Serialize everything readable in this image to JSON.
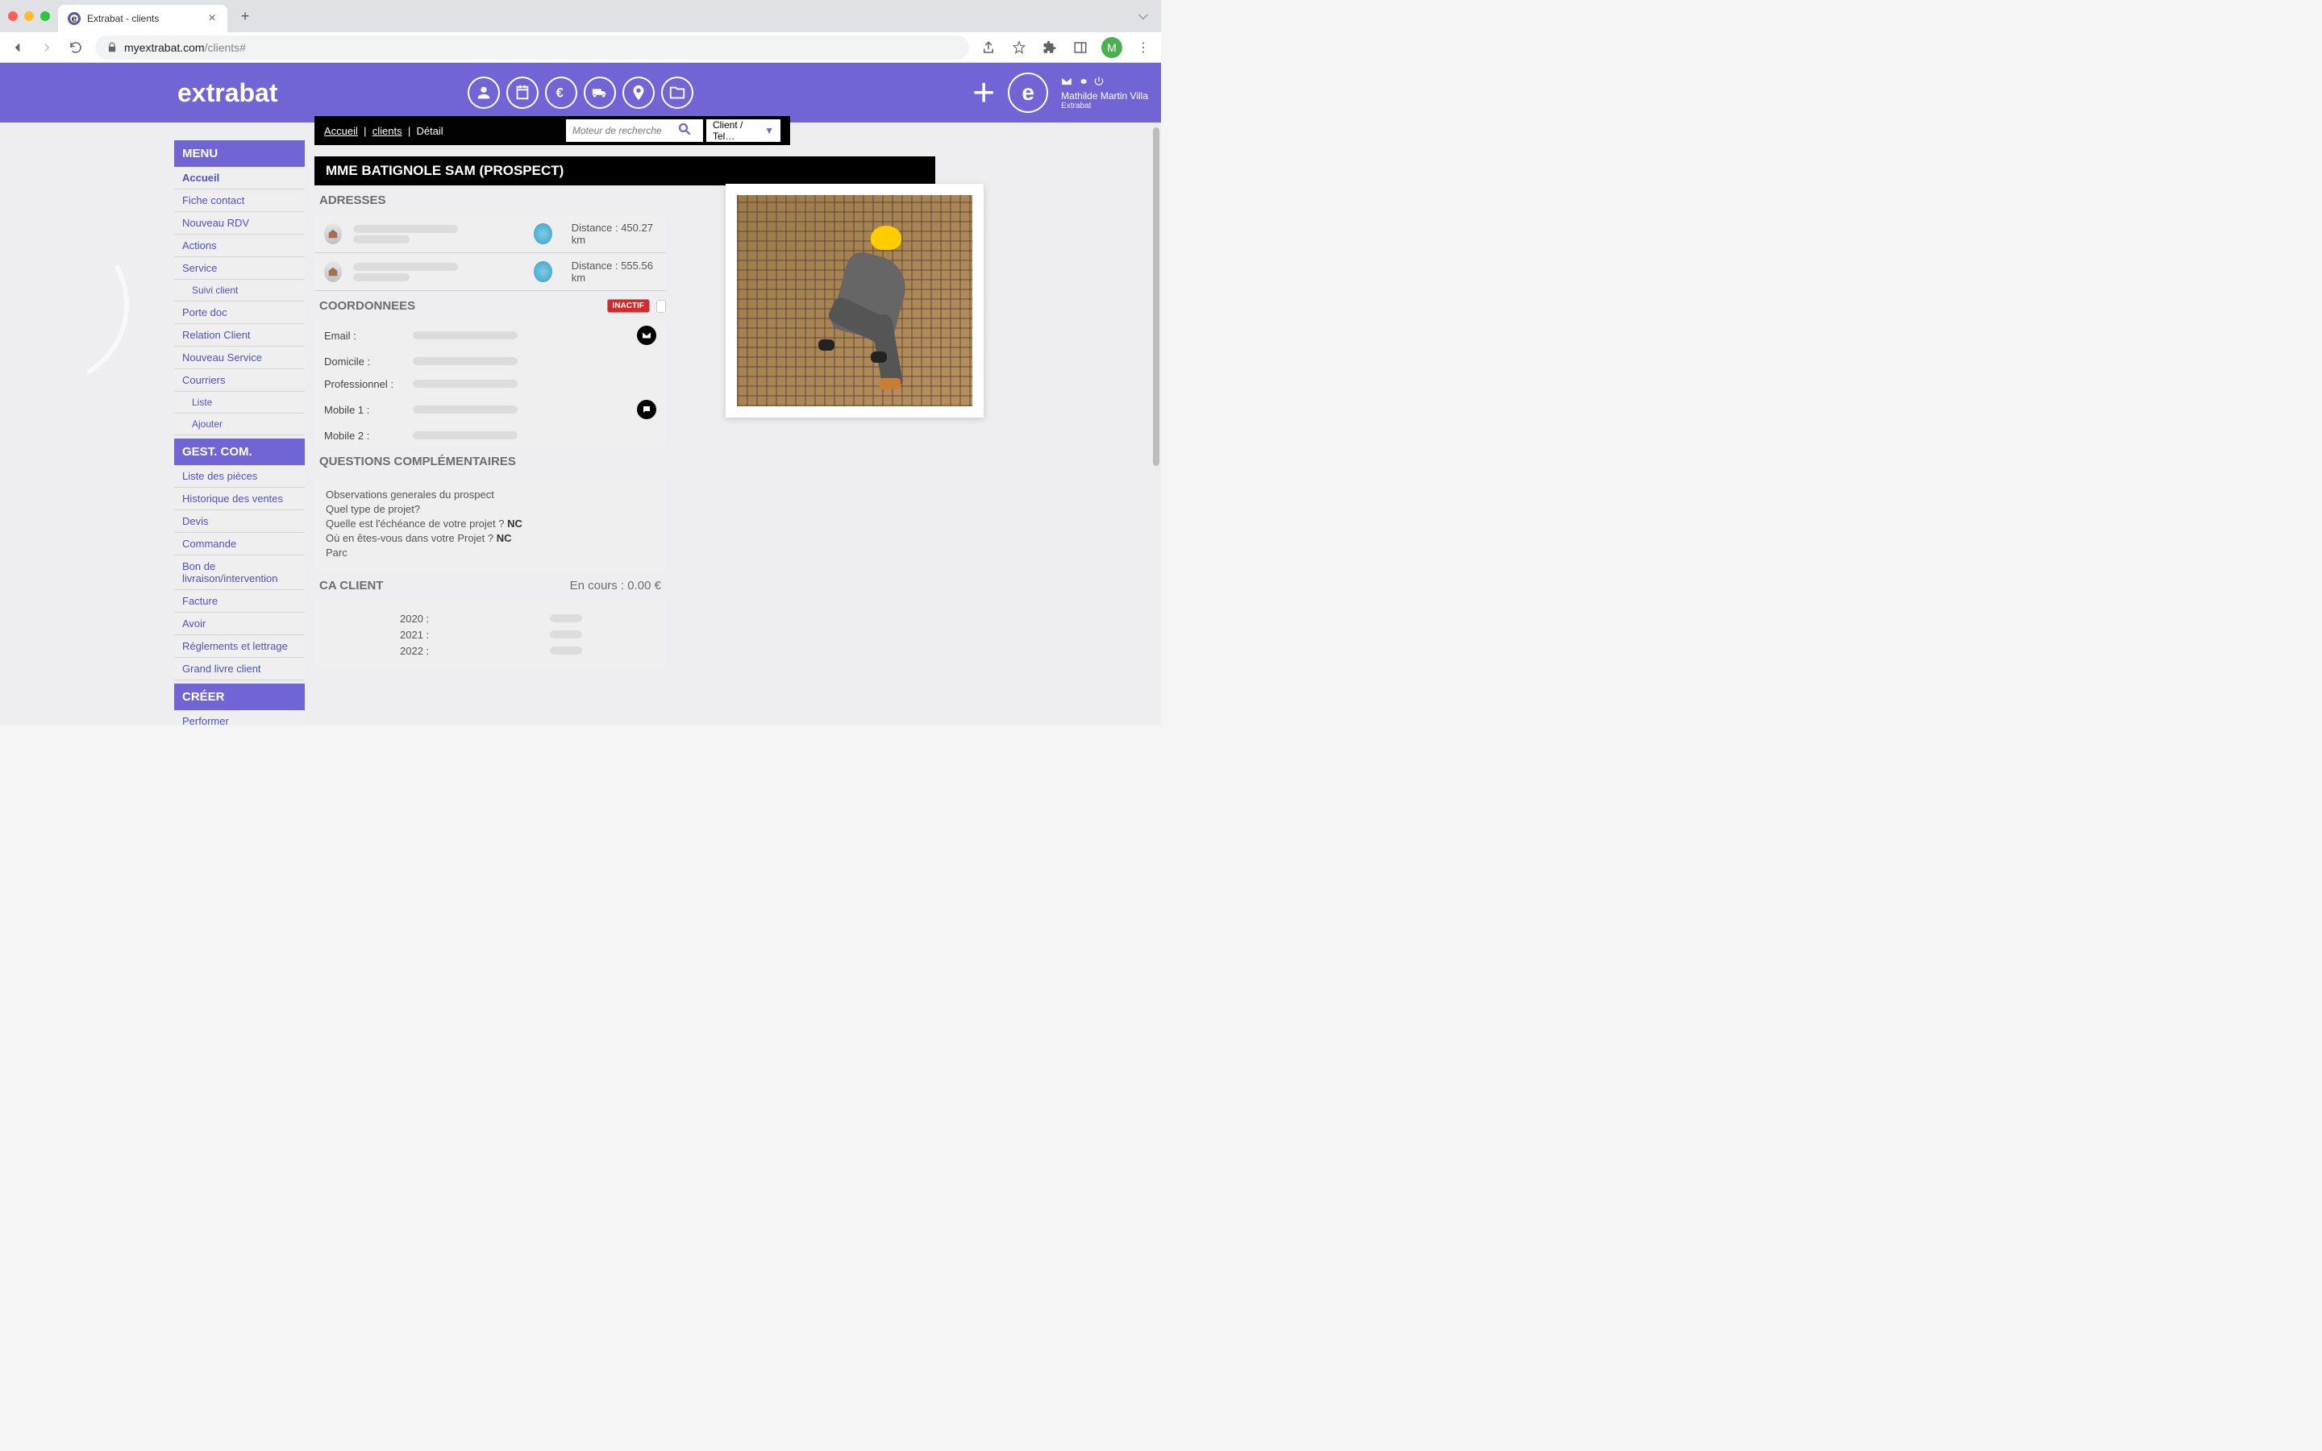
{
  "browser": {
    "tab_title": "Extrabat - clients",
    "url_domain": "myextrabat.com",
    "url_path": "/clients#",
    "avatar_initial": "M"
  },
  "header": {
    "logo": "extrabat",
    "user_name": "Mathilde Martin Villa",
    "user_company": "Extrabat"
  },
  "subheader": {
    "crumb_home": "Accueil",
    "crumb_clients": "clients",
    "crumb_detail": "Détail",
    "search_placeholder": "Moteur de recherche",
    "filter_label": "Client / Tel…"
  },
  "sidebar": {
    "menu_header": "MENU",
    "menu_items": [
      {
        "label": "Accueil",
        "active": true
      },
      {
        "label": "Fiche contact"
      },
      {
        "label": "Nouveau RDV"
      },
      {
        "label": "Actions"
      },
      {
        "label": "Service"
      },
      {
        "label": "Suivi client",
        "sub": true
      },
      {
        "label": "Porte doc"
      },
      {
        "label": "Relation Client"
      },
      {
        "label": "Nouveau Service"
      },
      {
        "label": "Courriers"
      },
      {
        "label": "Liste",
        "sub": true
      },
      {
        "label": "Ajouter",
        "sub": true
      }
    ],
    "gest_header": "GEST. COM.",
    "gest_items": [
      {
        "label": "Liste des pièces"
      },
      {
        "label": "Historique des ventes"
      },
      {
        "label": "Devis"
      },
      {
        "label": "Commande"
      },
      {
        "label": "Bon de livraison/intervention"
      },
      {
        "label": "Facture"
      },
      {
        "label": "Avoir"
      },
      {
        "label": "Réglements et lettrage"
      },
      {
        "label": "Grand livre client"
      }
    ],
    "creer_header": "CRÉER",
    "creer_items": [
      {
        "label": "Performer"
      }
    ]
  },
  "main": {
    "client_title": "MME BATIGNOLE SAM (PROSPECT)",
    "adresses_title": "ADRESSES",
    "addresses": [
      {
        "distance": "Distance : 450.27 km"
      },
      {
        "distance": "Distance : 555.56 km"
      }
    ],
    "coord_title": "COORDONNEES",
    "inactif": "INACTIF",
    "coords": [
      {
        "label": "Email :",
        "action": "email"
      },
      {
        "label": "Domicile :"
      },
      {
        "label": "Professionnel :"
      },
      {
        "label": "Mobile 1 :",
        "action": "sms"
      },
      {
        "label": "Mobile 2 :"
      }
    ],
    "questions_title": "QUESTIONS COMPLÉMENTAIRES",
    "questions": [
      {
        "text": "Observations generales du prospect",
        "nc": ""
      },
      {
        "text": "Quel type de projet?",
        "nc": ""
      },
      {
        "text": "Quelle est l'échéance de votre projet ?",
        "nc": "NC"
      },
      {
        "text": "Où en êtes-vous dans votre Projet ?",
        "nc": "NC"
      },
      {
        "text": "Parc",
        "nc": ""
      }
    ],
    "ca_title": "CA CLIENT",
    "ca_encours": "En cours : 0.00 €",
    "ca_years": [
      {
        "label": "2020 :"
      },
      {
        "label": "2021 :"
      },
      {
        "label": "2022 :"
      }
    ]
  }
}
